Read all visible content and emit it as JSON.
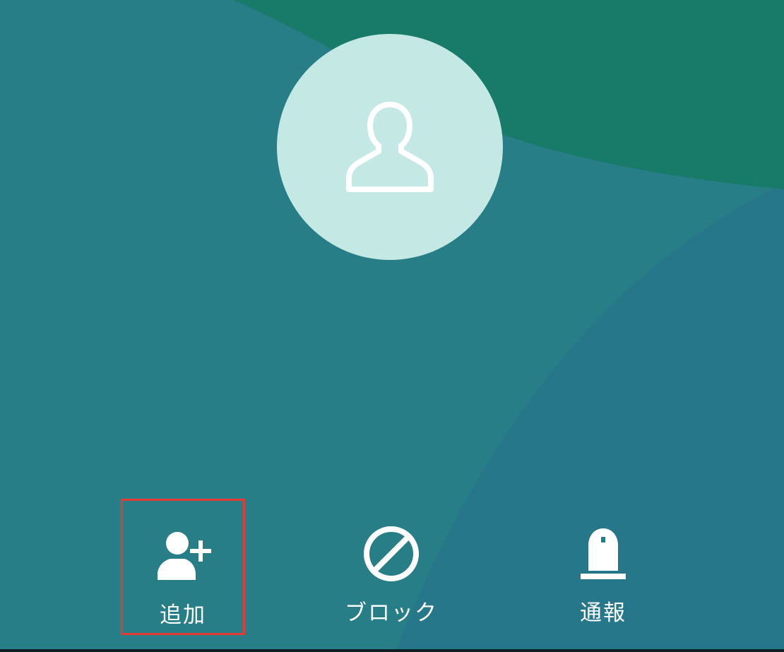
{
  "colors": {
    "background": "#277e86",
    "background_dark": "#24738b",
    "accent_green": "#187b69",
    "avatar_fill": "#c4e8e3",
    "icon_white": "#ffffff",
    "selection_border": "#e53935"
  },
  "avatar": {
    "icon": "person-outline-icon"
  },
  "actions": [
    {
      "label": "追加",
      "icon": "add-person-icon",
      "selected": true
    },
    {
      "label": "ブロック",
      "icon": "block-icon",
      "selected": false
    },
    {
      "label": "通報",
      "icon": "report-alarm-icon",
      "selected": false
    }
  ]
}
